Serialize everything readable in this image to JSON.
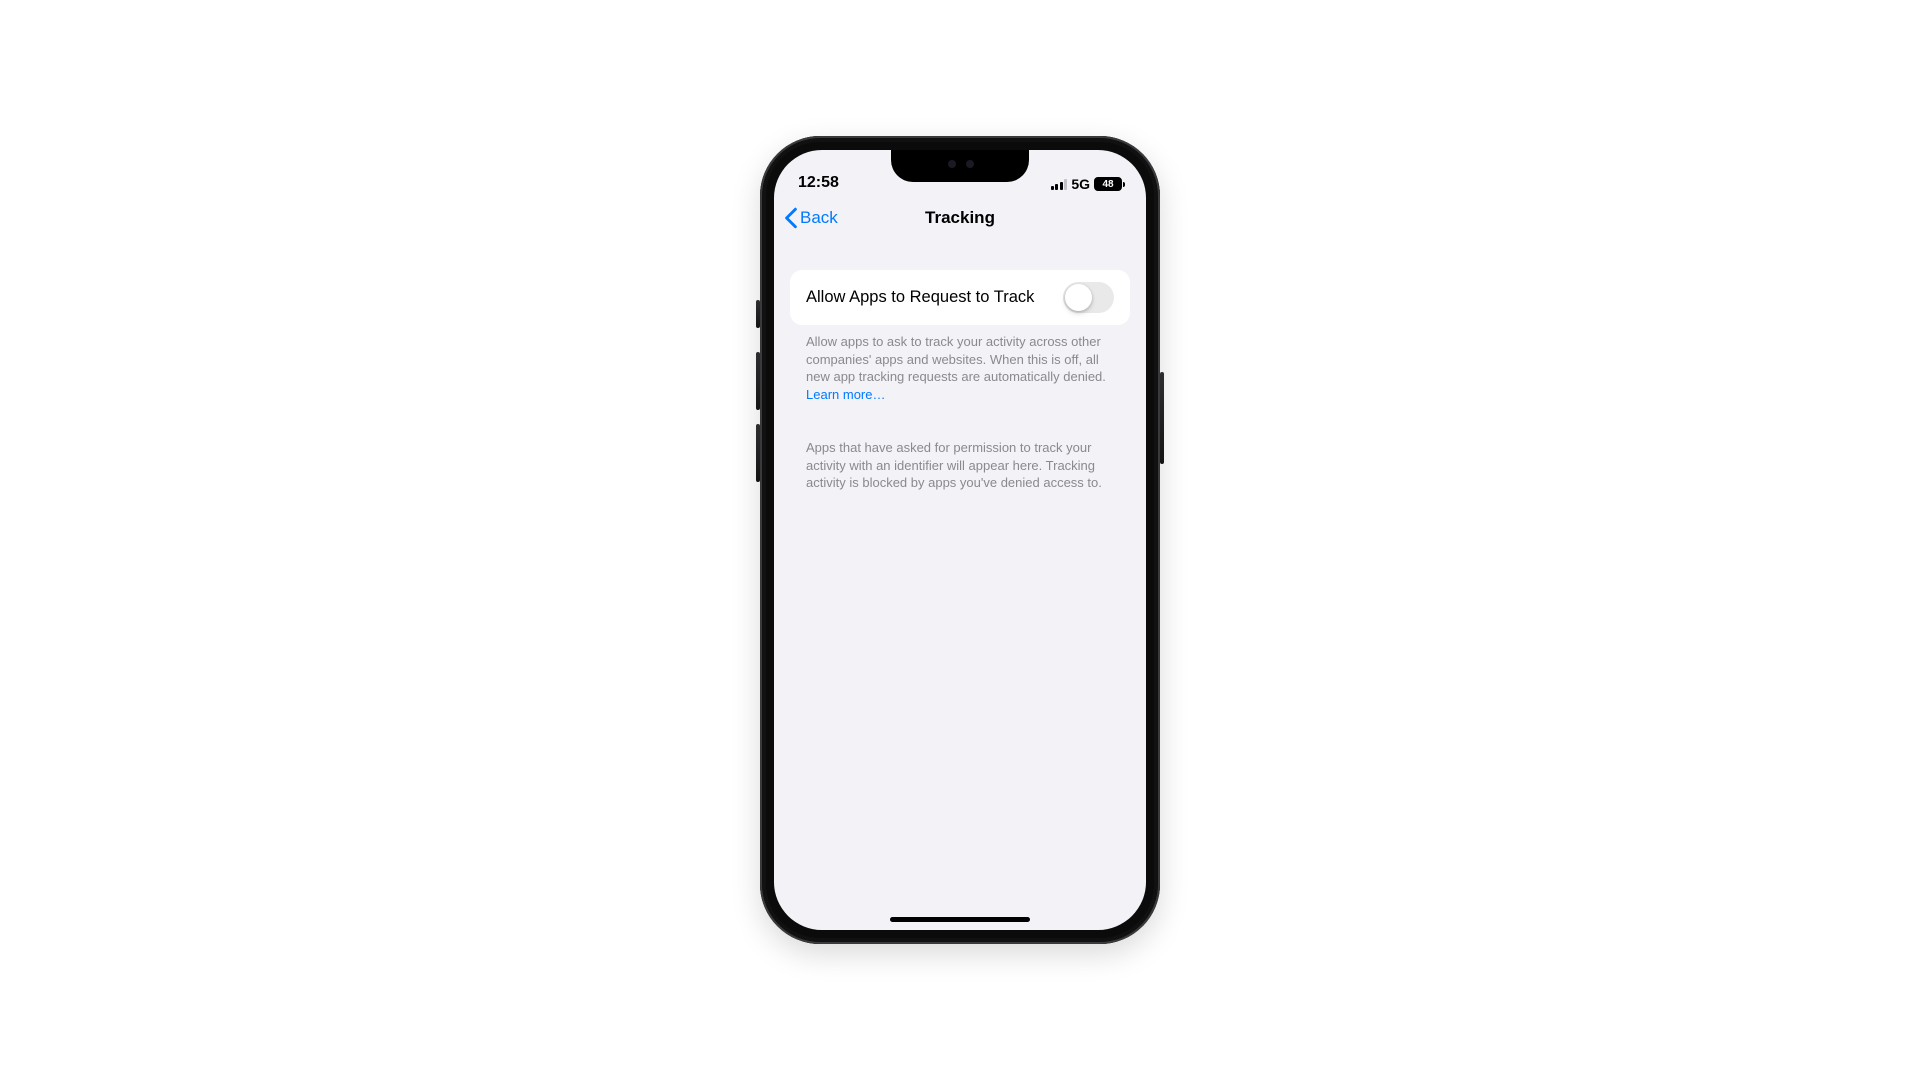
{
  "statusbar": {
    "time": "12:58",
    "network_type": "5G",
    "battery_percent": "48"
  },
  "nav": {
    "back_label": "Back",
    "title": "Tracking"
  },
  "setting_row": {
    "label": "Allow Apps to Request to Track",
    "value": false
  },
  "footnote1_text": "Allow apps to ask to track your activity across other companies' apps and websites. When this is off, all new app tracking requests are automatically denied. ",
  "footnote1_link": "Learn more…",
  "footnote2_text": "Apps that have asked for permission to track your activity with an identifier will appear here. Tracking activity is blocked by apps you've denied access to."
}
